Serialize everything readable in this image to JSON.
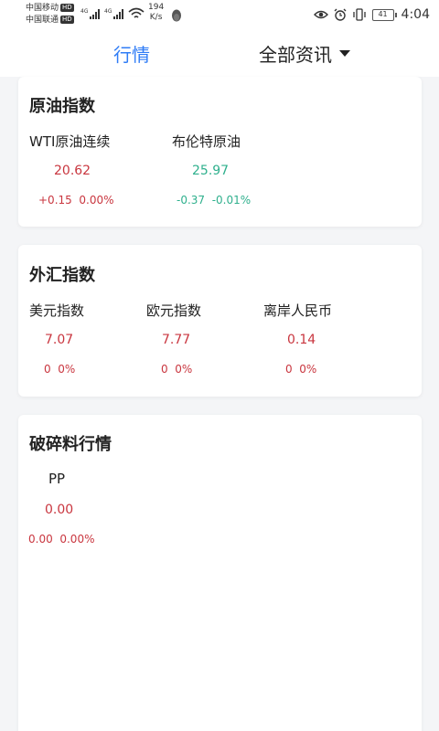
{
  "status_bar": {
    "carrier1": "中国移动",
    "carrier2": "中国联通",
    "hd": "HD",
    "net": "4G",
    "speed_value": "194",
    "speed_unit": "K/s",
    "battery": "41",
    "time": "4:04"
  },
  "header": {
    "tab_market": "行情",
    "tab_news": "全部资讯"
  },
  "sections": [
    {
      "title": "原油指数",
      "items": [
        {
          "name": "WTI原油连续",
          "price": "20.62",
          "change": "+0.15",
          "percent": "0.00%",
          "trend": "up"
        },
        {
          "name": "布伦特原油",
          "price": "25.97",
          "change": "-0.37",
          "percent": "-0.01%",
          "trend": "down"
        }
      ]
    },
    {
      "title": "外汇指数",
      "items": [
        {
          "name": "美元指数",
          "price": "7.07",
          "change": "0",
          "percent": "0%",
          "trend": "up"
        },
        {
          "name": "欧元指数",
          "price": "7.77",
          "change": "0",
          "percent": "0%",
          "trend": "up"
        },
        {
          "name": "离岸人民币",
          "price": "0.14",
          "change": "0",
          "percent": "0%",
          "trend": "up"
        }
      ]
    },
    {
      "title": "破碎料行情",
      "items": [
        {
          "name": "PP",
          "price": "0.00",
          "change": "0.00",
          "percent": "0.00%",
          "trend": "up"
        }
      ]
    }
  ],
  "colors": {
    "accent": "#2f7cf6",
    "up": "#c9363f",
    "down": "#2fb08d"
  }
}
